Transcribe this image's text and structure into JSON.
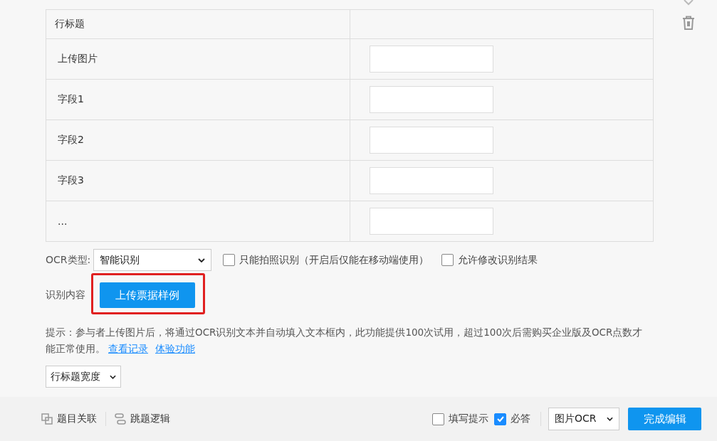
{
  "table": {
    "header": "行标题",
    "rows": [
      {
        "label": "上传图片"
      },
      {
        "label": "字段1"
      },
      {
        "label": "字段2"
      },
      {
        "label": "字段3"
      },
      {
        "label": "..."
      }
    ]
  },
  "ocr_type": {
    "label": "OCR类型:",
    "value": "智能识别"
  },
  "options": [
    {
      "label": "只能拍照识别（开启后仅能在移动端使用）",
      "checked": false
    },
    {
      "label": "允许修改识别结果",
      "checked": false
    }
  ],
  "recognize": {
    "label": "识别内容",
    "button": "上传票据样例"
  },
  "hint": {
    "text": "提示：参与者上传图片后，将通过OCR识别文本并自动填入文本框内，此功能提供100次试用，超过100次后需购买企业版及OCR点数才能正常使用。",
    "links": [
      "查看记录",
      "体验功能"
    ]
  },
  "width_select": "行标题宽度",
  "footer": {
    "left": [
      {
        "label": "题目关联",
        "kind": "link"
      },
      {
        "label": "跳题逻辑",
        "kind": "logic"
      }
    ],
    "checks": [
      {
        "label": "填写提示",
        "checked": false
      },
      {
        "label": "必答",
        "checked": true
      }
    ],
    "type_select": "图片OCR",
    "done": "完成编辑"
  }
}
